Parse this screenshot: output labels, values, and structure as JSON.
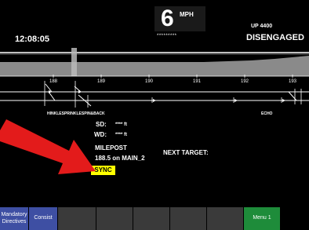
{
  "header": {
    "speed_value": "6",
    "speed_unit": "MPH",
    "speed_limit_mask": "*********",
    "clock": "12:08:05",
    "locomotive_id": "UP  4400",
    "brake_state": "DISENGAGED"
  },
  "track": {
    "mileposts": [
      {
        "label": "188",
        "position": 188
      },
      {
        "label": "189",
        "position": 189
      },
      {
        "label": "190",
        "position": 190
      },
      {
        "label": "191",
        "position": 191
      },
      {
        "label": "192",
        "position": 192
      },
      {
        "label": "193",
        "position": 193
      }
    ],
    "location_labels": {
      "left_stack": "HINKLESPRINKLESPIN&BACK",
      "right": "ECHO"
    }
  },
  "info": {
    "sd_label": "SD:",
    "sd_value": "**** ft",
    "wd_label": "WD:",
    "wd_value": "**** ft",
    "milepost_label": "MILEPOST",
    "milepost_value": "188.5  on  MAIN_2",
    "next_target_label": "NEXT TARGET:",
    "sync_label": "SYNC"
  },
  "softkeys": [
    {
      "label": "Mandatory\nDirectives",
      "style": "blue"
    },
    {
      "label": "Consist",
      "style": "blue"
    },
    {
      "label": "",
      "style": "gray"
    },
    {
      "label": "",
      "style": "gray"
    },
    {
      "label": "",
      "style": "gray"
    },
    {
      "label": "",
      "style": "gray"
    },
    {
      "label": "",
      "style": "gray"
    },
    {
      "label": "Menu 1",
      "style": "green"
    }
  ],
  "colors": {
    "panel": "#000000",
    "sync": "#ffff00",
    "softkey_blue": "#3e4fa3",
    "softkey_green": "#1e8c3a",
    "arrow": "#e31b1b"
  }
}
